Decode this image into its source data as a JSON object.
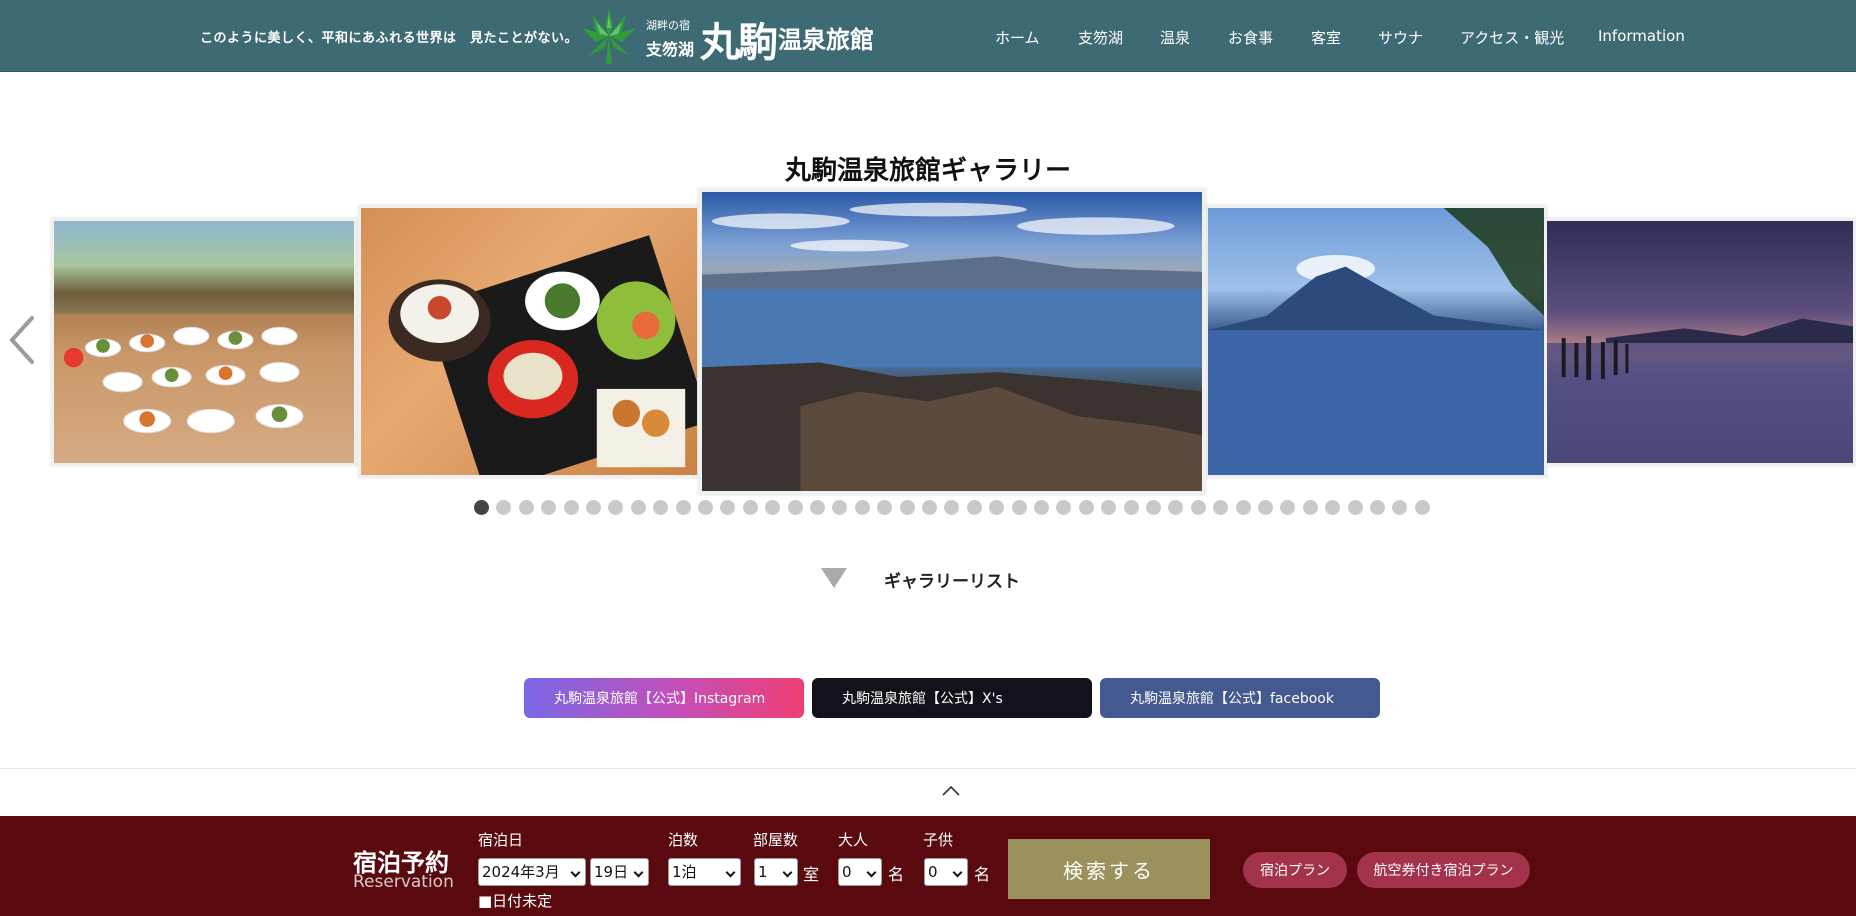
{
  "header": {
    "tagline": "このように美しく、平和にあふれる世界は　見たことがない。",
    "logo": {
      "small": "湖畔の宿",
      "lake": "支笏湖",
      "maru": "丸駒",
      "onsen": "温泉旅館"
    },
    "nav": [
      "ホーム",
      "支笏湖",
      "温泉",
      "お食事",
      "客室",
      "サウナ",
      "アクセス・観光",
      "Information"
    ]
  },
  "gallery": {
    "title": "丸駒温泉旅館ギャラリー",
    "slides": [
      "buffet-photo",
      "meal-set-photo",
      "lake-panorama-photo",
      "mountain-lake-photo",
      "sunset-lake-photo"
    ],
    "dot_count": 43,
    "active_dot": 0,
    "list_label": "ギャラリーリスト"
  },
  "sns": {
    "instagram": "丸駒温泉旅館【公式】Instagram",
    "x": "丸駒温泉旅館【公式】X's",
    "facebook": "丸駒温泉旅館【公式】facebook"
  },
  "reservation": {
    "title": "宿泊予約",
    "subtitle": "Reservation",
    "date_label": "宿泊日",
    "month_value": "2024年3月",
    "day_value": "19日",
    "undecided_label": "■日付未定",
    "nights_label": "泊数",
    "nights_value": "1泊",
    "rooms_label": "部屋数",
    "rooms_value": "1",
    "rooms_unit": "室",
    "adults_label": "大人",
    "adults_value": "0",
    "adults_unit": "名",
    "children_label": "子供",
    "children_value": "0",
    "children_unit": "名",
    "search_label": "検索する",
    "plan_label": "宿泊プラン",
    "air_plan_label": "航空券付き宿泊プラン"
  },
  "colors": {
    "header_bg": "#3e6a74",
    "reservation_bg": "#5a0a0e",
    "search_button": "#9a915c",
    "pill": "#a2334a",
    "x_button": "#12131a",
    "facebook_button": "#44598f"
  }
}
